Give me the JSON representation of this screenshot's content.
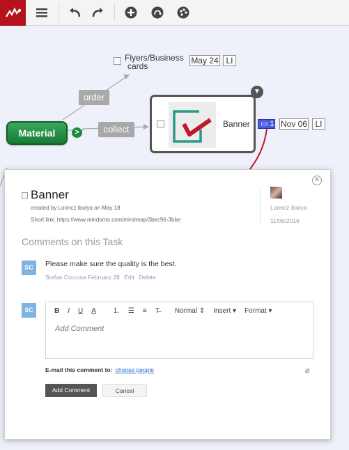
{
  "toolbar": {
    "icons": [
      "app-logo-icon",
      "menu-icon",
      "undo-icon",
      "redo-icon",
      "add-topic-icon",
      "relationship-icon",
      "style-palette-icon"
    ]
  },
  "map": {
    "central": "Material",
    "expand_symbol": ">",
    "relations": [
      "order",
      "collect"
    ],
    "topic_flyers": {
      "line1": "Flyers/Business",
      "line2": "cards",
      "date": "May 24",
      "assignee": "LI"
    },
    "topic_banner": {
      "label": "Banner",
      "comments": "1",
      "date": "Nov 06",
      "assignee": "LI"
    },
    "accent_color": "#b5121b"
  },
  "dialog": {
    "title": "Banner",
    "created_by": "created by Lorincz Ibolya on May 18",
    "short_link_label": "Short link:",
    "short_link": "https://www.mindomo.com/mindmap/3bec96-3bbe",
    "owner": "Lorincz Ibolya",
    "owner_date": "11/06/2016",
    "section_heading": "Comments on this Task",
    "comment": {
      "avatar": "SC",
      "text": "Please make sure the quality is the best.",
      "author_date": "Stefan Corcosa February 28",
      "edit": "Edit",
      "delete": "Delete"
    },
    "editor": {
      "avatar": "SC",
      "bold": "B",
      "italic": "I",
      "underline": "U",
      "color": "A",
      "normal": "Normal",
      "insert": "Insert",
      "format": "Format",
      "placeholder": "Add Comment"
    },
    "email_label": "E-mail this comment to:",
    "choose_people": "choose people",
    "add_button": "Add Comment",
    "cancel_button": "Cancel"
  }
}
